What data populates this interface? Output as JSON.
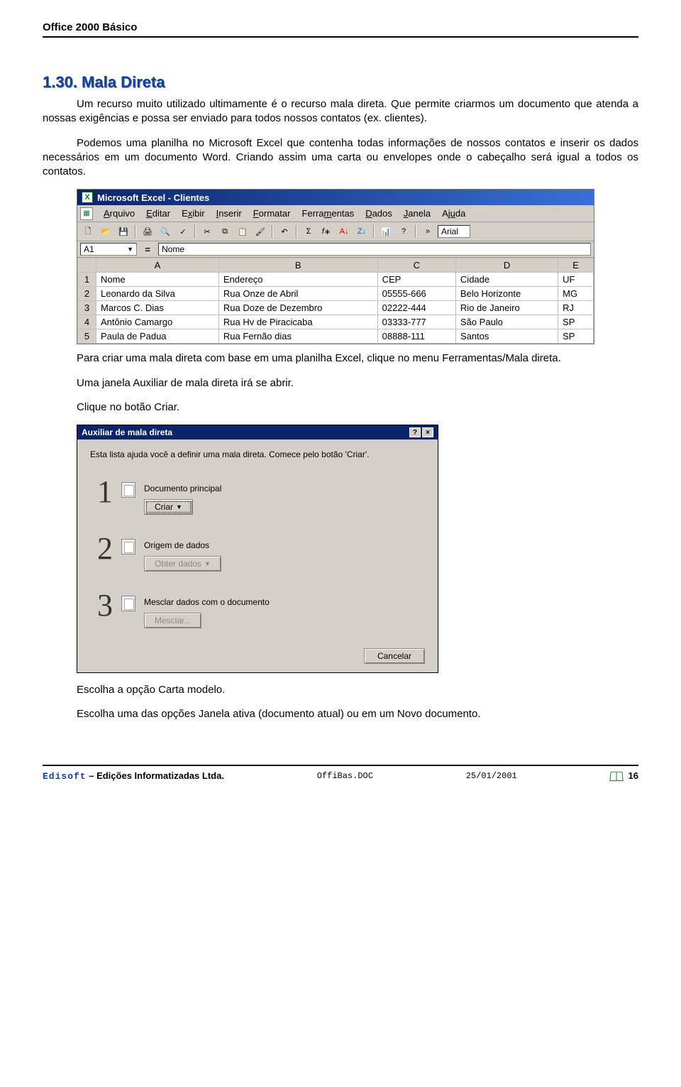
{
  "header": {
    "title": "Office 2000 Básico"
  },
  "section": {
    "heading": "1.30. Mala Direta",
    "p1": "Um recurso muito utilizado ultimamente é o recurso mala direta. Que permite criarmos um documento que atenda a nossas exigências e possa ser enviado para todos nossos contatos (ex. clientes).",
    "p2": "Podemos uma planilha no Microsoft Excel que contenha todas informações de nossos contatos e inserir os dados necessários em um documento Word. Criando assim uma carta ou envelopes onde o cabeçalho será igual a todos os contatos.",
    "p3": "Para criar uma mala direta com base em uma planilha Excel, clique no menu Ferramentas/Mala direta.",
    "p4": "Uma janela Auxiliar de mala direta irá se abrir.",
    "p5": "Clique no botão Criar.",
    "p6": "Escolha a opção Carta modelo.",
    "p7": "Escolha uma das opções Janela ativa (documento atual) ou em um Novo documento."
  },
  "excel": {
    "title": "Microsoft Excel - Clientes",
    "menus": [
      "Arquivo",
      "Editar",
      "Exibir",
      "Inserir",
      "Formatar",
      "Ferramentas",
      "Dados",
      "Janela",
      "Ajuda"
    ],
    "cell_ref": "A1",
    "formula_value": "Nome",
    "font": "Arial",
    "col_headers": [
      "A",
      "B",
      "C",
      "D",
      "E"
    ],
    "row1": [
      "Nome",
      "Endereço",
      "CEP",
      "Cidade",
      "UF"
    ],
    "rows": [
      [
        "Leonardo da Silva",
        "Rua Onze de Abril",
        "05555-666",
        "Belo Horizonte",
        "MG"
      ],
      [
        "Marcos C. Dias",
        "Rua Doze de Dezembro",
        "02222-444",
        "Rio de Janeiro",
        "RJ"
      ],
      [
        "Antônio Camargo",
        "Rua Hv de Piracicaba",
        "03333-777",
        "São Paulo",
        "SP"
      ],
      [
        "Paula de Padua",
        "Rua Fernão dias",
        "08888-111",
        "Santos",
        "SP"
      ]
    ]
  },
  "dialog": {
    "title": "Auxiliar de mala direta",
    "intro": "Esta lista ajuda você a definir uma mala direta. Comece pelo botão 'Criar'.",
    "step1": {
      "label": "Documento principal",
      "button": "Criar"
    },
    "step2": {
      "label": "Origem de dados",
      "button": "Obter dados"
    },
    "step3": {
      "label": "Mesclar dados com o documento",
      "button": "Mesclar..."
    },
    "cancel": "Cancelar"
  },
  "footer": {
    "brand": "Edisoft",
    "company": " – Edições Informatizadas Ltda.",
    "file": "OffiBas.DOC",
    "date": "25/01/2001",
    "page": "16"
  }
}
